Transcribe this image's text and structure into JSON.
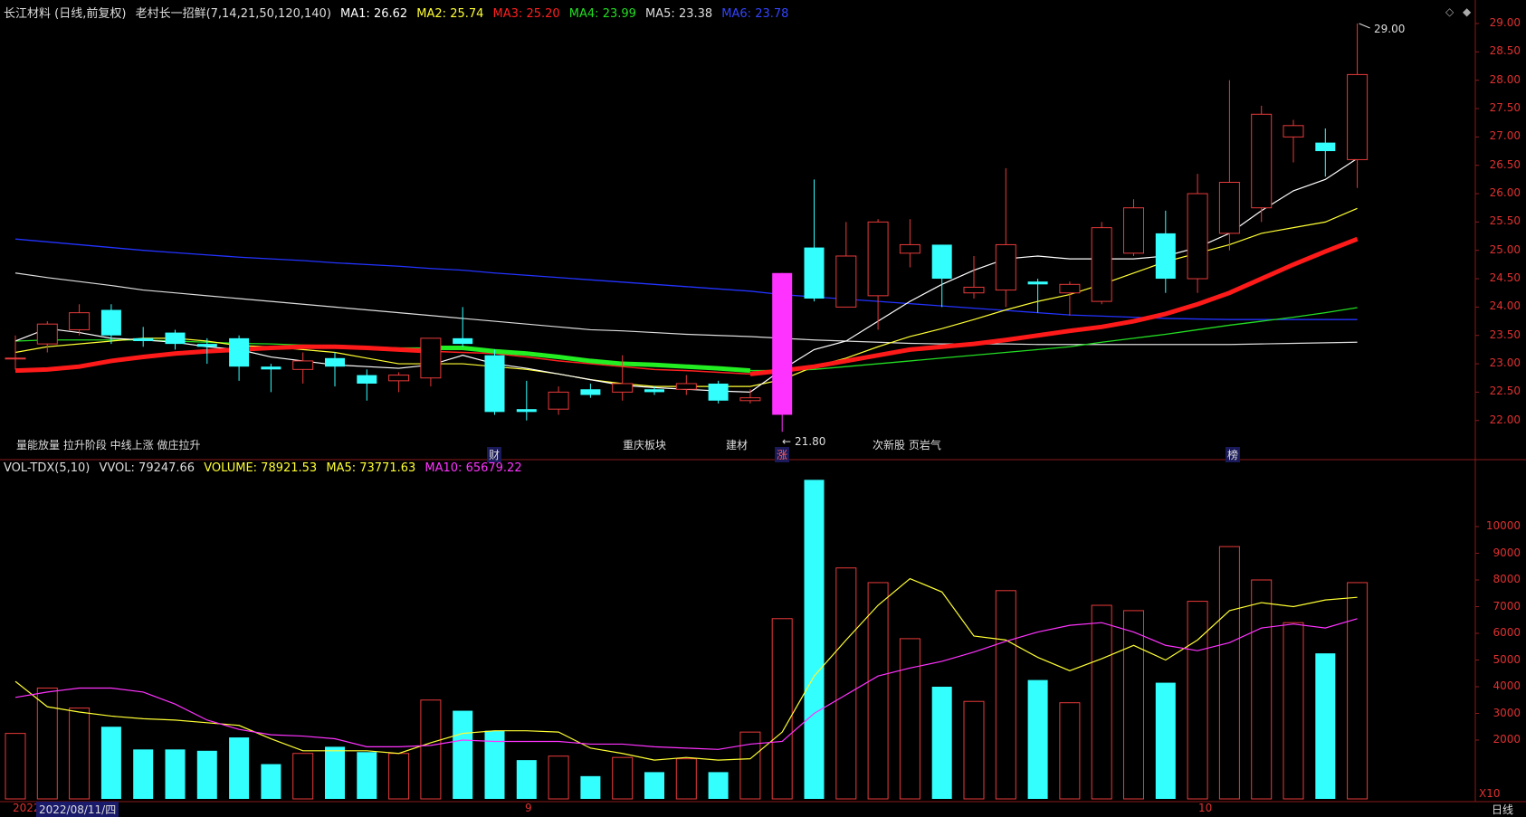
{
  "header": {
    "title": "长江材料 (日线,前复权)",
    "indicator": "老村长一招鲜(7,14,21,50,120,140)",
    "ma1": "MA1: 26.62",
    "ma2": "MA2: 25.74",
    "ma3": "MA3: 25.20",
    "ma4": "MA4: 23.99",
    "ma5": "MA5: 23.38",
    "ma6": "MA6: 23.78"
  },
  "vol_header": {
    "name": "VOL-TDX(5,10)",
    "vvol": "VVOL: 79247.66",
    "volume": "VOLUME: 78921.53",
    "ma5": "MA5: 73771.63",
    "ma10": "MA10: 65679.22"
  },
  "annotations": {
    "strategy": "量能放量 拉升阶段 中线上涨 做庄拉升",
    "mark_cai": "财",
    "chongqing": "重庆板块",
    "jiancai": "建材",
    "mark_zhang": "涨",
    "low_price": "21.80",
    "low_arrow": "←",
    "cixingu": "次新股 页岩气",
    "mark_bang": "榜",
    "high_price": "29.00",
    "unit": "X10",
    "period": "日线"
  },
  "date_bar": {
    "year": "2022",
    "selected_date": "2022/08/11/四",
    "month9": "9",
    "month10": "10"
  },
  "colors": {
    "up": "#e83a3a",
    "down": "#33ffff",
    "ma1": "#ffffff",
    "ma2": "#ffff33",
    "ma3": "#ff2020",
    "ma4": "#22dd22",
    "ma5": "#dddddd",
    "ma6": "#2233ff",
    "vol_ma5": "#ffff33",
    "vol_ma10": "#ff33ff",
    "special": "#ff33ff"
  },
  "chart_data": [
    {
      "type": "candlestick",
      "title": "长江材料 (日线,前复权)",
      "ylim": [
        21.6,
        29.2
      ],
      "y_ticks": [
        "22.00",
        "22.50",
        "23.00",
        "23.50",
        "24.00",
        "24.50",
        "25.00",
        "25.50",
        "26.00",
        "26.50",
        "27.00",
        "27.50",
        "28.00",
        "28.50",
        "29.00"
      ],
      "candles": [
        {
          "o": 23.1,
          "h": 23.5,
          "l": 22.9,
          "c": 23.1
        },
        {
          "o": 23.35,
          "h": 23.75,
          "l": 23.2,
          "c": 23.7
        },
        {
          "o": 23.6,
          "h": 24.05,
          "l": 23.5,
          "c": 23.9
        },
        {
          "o": 23.95,
          "h": 24.05,
          "l": 23.35,
          "c": 23.5
        },
        {
          "o": 23.45,
          "h": 23.65,
          "l": 23.3,
          "c": 23.4
        },
        {
          "o": 23.55,
          "h": 23.6,
          "l": 23.25,
          "c": 23.35
        },
        {
          "o": 23.35,
          "h": 23.45,
          "l": 23.0,
          "c": 23.3
        },
        {
          "o": 23.45,
          "h": 23.5,
          "l": 22.7,
          "c": 22.95
        },
        {
          "o": 22.95,
          "h": 23.0,
          "l": 22.5,
          "c": 22.9
        },
        {
          "o": 22.9,
          "h": 23.2,
          "l": 22.65,
          "c": 23.05
        },
        {
          "o": 23.1,
          "h": 23.2,
          "l": 22.6,
          "c": 22.95
        },
        {
          "o": 22.8,
          "h": 22.9,
          "l": 22.35,
          "c": 22.65
        },
        {
          "o": 22.7,
          "h": 22.85,
          "l": 22.5,
          "c": 22.8
        },
        {
          "o": 22.75,
          "h": 23.45,
          "l": 22.6,
          "c": 23.45
        },
        {
          "o": 23.45,
          "h": 24.0,
          "l": 23.3,
          "c": 23.35
        },
        {
          "o": 23.15,
          "h": 23.25,
          "l": 22.1,
          "c": 22.15
        },
        {
          "o": 22.2,
          "h": 22.7,
          "l": 22.0,
          "c": 22.15
        },
        {
          "o": 22.2,
          "h": 22.6,
          "l": 22.1,
          "c": 22.5
        },
        {
          "o": 22.55,
          "h": 22.65,
          "l": 22.4,
          "c": 22.45
        },
        {
          "o": 22.5,
          "h": 23.15,
          "l": 22.35,
          "c": 22.65
        },
        {
          "o": 22.55,
          "h": 22.6,
          "l": 22.45,
          "c": 22.5
        },
        {
          "o": 22.55,
          "h": 22.8,
          "l": 22.45,
          "c": 22.65
        },
        {
          "o": 22.65,
          "h": 22.7,
          "l": 22.3,
          "c": 22.35
        },
        {
          "o": 22.35,
          "h": 22.55,
          "l": 22.3,
          "c": 22.4
        },
        {
          "o": 22.1,
          "h": 24.6,
          "l": 21.8,
          "c": 24.6
        },
        {
          "o": 25.05,
          "h": 26.25,
          "l": 24.1,
          "c": 24.15
        },
        {
          "o": 24.0,
          "h": 25.5,
          "l": 24.0,
          "c": 24.9
        },
        {
          "o": 24.2,
          "h": 25.55,
          "l": 23.6,
          "c": 25.5
        },
        {
          "o": 24.95,
          "h": 25.55,
          "l": 24.7,
          "c": 25.1
        },
        {
          "o": 25.1,
          "h": 25.1,
          "l": 24.0,
          "c": 24.5
        },
        {
          "o": 24.25,
          "h": 24.9,
          "l": 24.15,
          "c": 24.35
        },
        {
          "o": 24.3,
          "h": 26.45,
          "l": 24.0,
          "c": 25.1
        },
        {
          "o": 24.45,
          "h": 24.5,
          "l": 23.9,
          "c": 24.4
        },
        {
          "o": 24.25,
          "h": 24.45,
          "l": 23.85,
          "c": 24.4
        },
        {
          "o": 24.1,
          "h": 25.5,
          "l": 24.05,
          "c": 25.4
        },
        {
          "o": 24.95,
          "h": 25.9,
          "l": 24.9,
          "c": 25.75
        },
        {
          "o": 25.3,
          "h": 25.7,
          "l": 24.25,
          "c": 24.5
        },
        {
          "o": 24.5,
          "h": 26.35,
          "l": 24.25,
          "c": 26.0
        },
        {
          "o": 25.3,
          "h": 28.0,
          "l": 25.0,
          "c": 26.2
        },
        {
          "o": 25.75,
          "h": 27.55,
          "l": 25.5,
          "c": 27.4
        },
        {
          "o": 27.0,
          "h": 27.3,
          "l": 26.55,
          "c": 27.2
        },
        {
          "o": 26.9,
          "h": 27.15,
          "l": 26.3,
          "c": 26.75
        },
        {
          "o": 26.6,
          "h": 29.0,
          "l": 26.1,
          "c": 28.1
        }
      ],
      "ma_lines": {
        "MA1": [
          23.4,
          23.62,
          23.55,
          23.45,
          23.42,
          23.38,
          23.3,
          23.25,
          23.12,
          23.05,
          22.98,
          22.95,
          22.92,
          22.98,
          23.15,
          23.0,
          22.92,
          22.82,
          22.72,
          22.62,
          22.58,
          22.55,
          22.52,
          22.5,
          22.9,
          23.25,
          23.4,
          23.75,
          24.1,
          24.4,
          24.65,
          24.85,
          24.9,
          24.85,
          24.85,
          24.85,
          24.9,
          25.05,
          25.3,
          25.7,
          26.05,
          26.25,
          26.62
        ],
        "MA2": [
          23.2,
          23.3,
          23.35,
          23.4,
          23.45,
          23.45,
          23.4,
          23.32,
          23.3,
          23.25,
          23.2,
          23.1,
          23.0,
          23.0,
          23.0,
          22.95,
          22.9,
          22.82,
          22.72,
          22.65,
          22.6,
          22.6,
          22.6,
          22.6,
          22.72,
          22.95,
          23.1,
          23.3,
          23.48,
          23.62,
          23.78,
          23.95,
          24.1,
          24.22,
          24.4,
          24.6,
          24.8,
          24.95,
          25.1,
          25.3,
          25.4,
          25.5,
          25.74
        ],
        "MA3": [
          22.88,
          22.9,
          22.95,
          23.05,
          23.12,
          23.18,
          23.22,
          23.25,
          23.28,
          23.3,
          23.3,
          23.28,
          23.25,
          23.22,
          23.2,
          23.18,
          23.12,
          23.05,
          23.0,
          22.95,
          22.9,
          22.88,
          22.85,
          22.82,
          22.88,
          22.95,
          23.05,
          23.15,
          23.25,
          23.3,
          23.35,
          23.42,
          23.5,
          23.58,
          23.65,
          23.75,
          23.88,
          24.05,
          24.25,
          24.5,
          24.75,
          24.98,
          25.2
        ],
        "MA4": [
          23.4,
          23.42,
          23.42,
          23.42,
          23.42,
          23.4,
          23.38,
          23.36,
          23.35,
          23.33,
          23.32,
          23.3,
          23.28,
          23.28,
          23.28,
          23.22,
          23.18,
          23.12,
          23.05,
          23.0,
          22.98,
          22.95,
          22.92,
          22.88,
          22.88,
          22.9,
          22.95,
          23.0,
          23.05,
          23.1,
          23.15,
          23.2,
          23.25,
          23.3,
          23.38,
          23.45,
          23.52,
          23.6,
          23.68,
          23.75,
          23.82,
          23.9,
          23.99
        ],
        "MA5": [
          24.6,
          24.52,
          24.45,
          24.38,
          24.3,
          24.25,
          24.2,
          24.15,
          24.1,
          24.05,
          24.0,
          23.95,
          23.9,
          23.85,
          23.8,
          23.75,
          23.7,
          23.65,
          23.6,
          23.58,
          23.55,
          23.52,
          23.5,
          23.48,
          23.45,
          23.42,
          23.4,
          23.38,
          23.36,
          23.35,
          23.35,
          23.35,
          23.34,
          23.34,
          23.34,
          23.34,
          23.34,
          23.34,
          23.34,
          23.35,
          23.36,
          23.37,
          23.38
        ],
        "MA6": [
          25.2,
          25.15,
          25.1,
          25.05,
          25.0,
          24.96,
          24.92,
          24.88,
          24.85,
          24.82,
          24.78,
          24.75,
          24.72,
          24.68,
          24.65,
          24.6,
          24.56,
          24.52,
          24.48,
          24.44,
          24.4,
          24.36,
          24.32,
          24.28,
          24.22,
          24.18,
          24.14,
          24.1,
          24.06,
          24.02,
          23.98,
          23.94,
          23.9,
          23.86,
          23.84,
          23.82,
          23.8,
          23.79,
          23.78,
          23.78,
          23.78,
          23.78,
          23.78
        ]
      }
    },
    {
      "type": "bar",
      "title": "VOL-TDX(5,10)",
      "ylim": [
        0,
        12000
      ],
      "y_ticks": [
        "2000",
        "3000",
        "4000",
        "5000",
        "6000",
        "7000",
        "8000",
        "9000",
        "10000"
      ],
      "unit": "X10",
      "volumes": [
        2250,
        3950,
        3200,
        2500,
        1650,
        1650,
        1600,
        2100,
        1100,
        1500,
        1750,
        1550,
        1500,
        3500,
        3100,
        2350,
        1250,
        1400,
        650,
        1350,
        800,
        1300,
        800,
        2300,
        6550,
        11750,
        8450,
        7900,
        5800,
        4000,
        3450,
        7600,
        4250,
        3400,
        7050,
        6850,
        4150,
        7200,
        9250,
        8000,
        6400,
        5250,
        7900
      ],
      "vol_ma5": [
        4200,
        3250,
        3050,
        2900,
        2800,
        2750,
        2650,
        2550,
        2050,
        1600,
        1600,
        1600,
        1500,
        1900,
        2250,
        2350,
        2350,
        2300,
        1700,
        1500,
        1250,
        1350,
        1250,
        1300,
        2300,
        4400,
        5750,
        7050,
        8050,
        7550,
        5900,
        5750,
        5100,
        4600,
        5050,
        5550,
        5000,
        5750,
        6850,
        7150,
        7000,
        7250,
        7350
      ],
      "vol_ma10": [
        3600,
        3800,
        3950,
        3950,
        3800,
        3350,
        2750,
        2400,
        2200,
        2150,
        2050,
        1750,
        1750,
        1800,
        2000,
        1950,
        1950,
        1950,
        1850,
        1850,
        1750,
        1700,
        1650,
        1850,
        1950,
        3000,
        3700,
        4400,
        4700,
        4950,
        5300,
        5700,
        6050,
        6300,
        6400,
        6050,
        5550,
        5350,
        5650,
        6200,
        6350,
        6200,
        6550
      ]
    }
  ]
}
